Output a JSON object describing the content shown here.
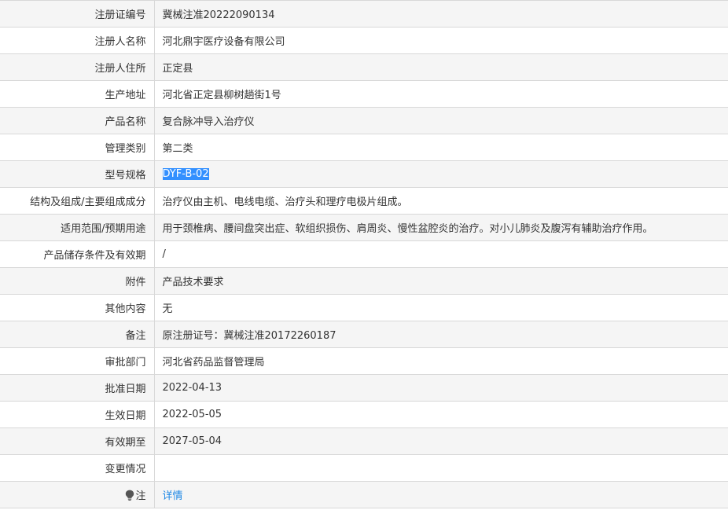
{
  "rows": [
    {
      "label": "注册证编号",
      "value": "冀械注准20222090134"
    },
    {
      "label": "注册人名称",
      "value": "河北鼎宇医疗设备有限公司"
    },
    {
      "label": "注册人住所",
      "value": "正定县"
    },
    {
      "label": "生产地址",
      "value": "河北省正定县柳树趟街1号"
    },
    {
      "label": "产品名称",
      "value": "复合脉冲导入治疗仪"
    },
    {
      "label": "管理类别",
      "value": "第二类"
    },
    {
      "label": "型号规格",
      "value": "DYF-B-02"
    },
    {
      "label": "结构及组成/主要组成成分",
      "value": "治疗仪由主机、电线电缆、治疗头和理疗电极片组成。"
    },
    {
      "label": "适用范围/预期用途",
      "value": "用于颈椎病、腰间盘突出症、软组织损伤、肩周炎、慢性盆腔炎的治疗。对小儿肺炎及腹泻有辅助治疗作用。"
    },
    {
      "label": "产品储存条件及有效期",
      "value": "/"
    },
    {
      "label": "附件",
      "value": "产品技术要求"
    },
    {
      "label": "其他内容",
      "value": "无"
    },
    {
      "label": "备注",
      "value": "原注册证号：冀械注准20172260187"
    },
    {
      "label": "审批部门",
      "value": "河北省药品监督管理局"
    },
    {
      "label": "批准日期",
      "value": "2022-04-13"
    },
    {
      "label": "生效日期",
      "value": "2022-05-05"
    },
    {
      "label": "有效期至",
      "value": "2027-05-04"
    },
    {
      "label": "变更情况",
      "value": ""
    }
  ],
  "note": {
    "icon": "lightbulb-icon",
    "label": "注",
    "link_text": "详情",
    "link_color": "#1e88e5"
  },
  "colors": {
    "row_odd": "#f5f5f5",
    "row_even": "#ffffff",
    "border": "#d8d8d8",
    "selection": "#3390ff"
  }
}
